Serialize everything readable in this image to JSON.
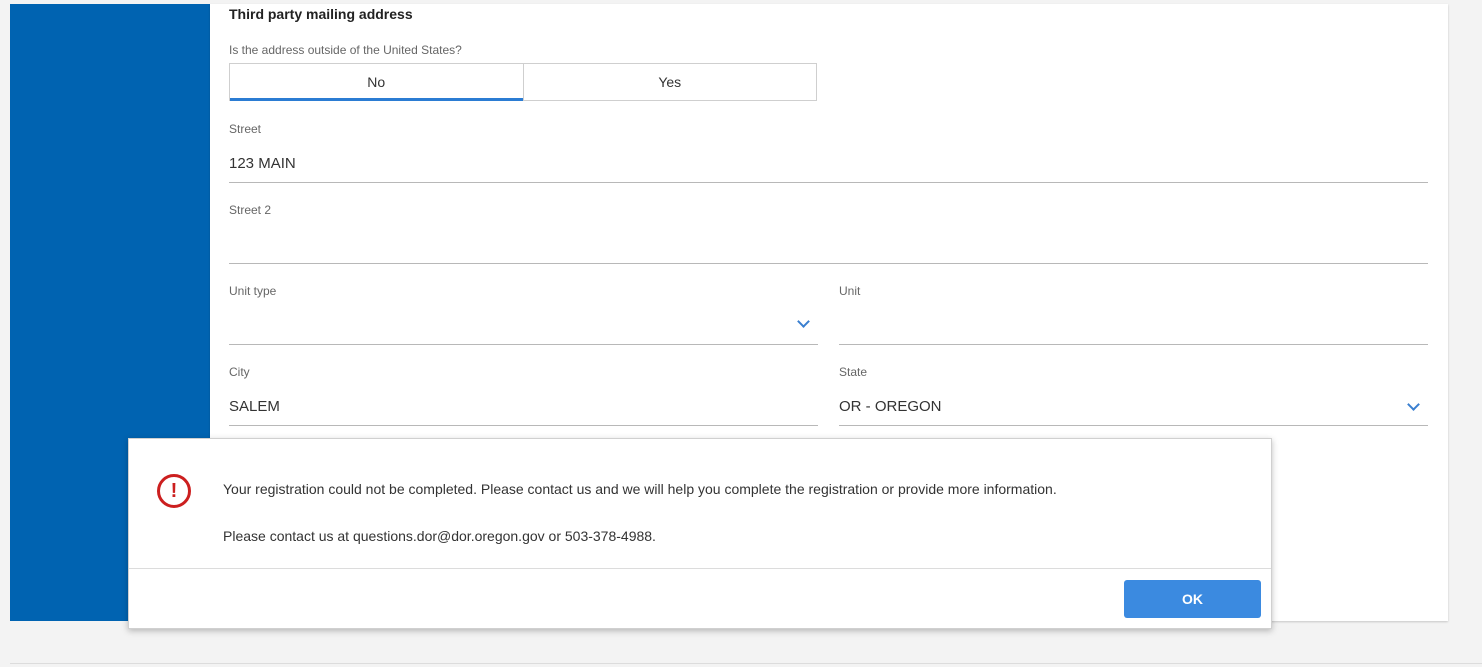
{
  "form": {
    "section_title": "Third party mailing address",
    "outside_us_question": "Is the address outside of the United States?",
    "toggle": {
      "no_label": "No",
      "yes_label": "Yes",
      "selected": "No"
    },
    "street": {
      "label": "Street",
      "value": "123 MAIN"
    },
    "street2": {
      "label": "Street 2",
      "value": ""
    },
    "unit_type": {
      "label": "Unit type",
      "value": ""
    },
    "unit": {
      "label": "Unit",
      "value": ""
    },
    "city": {
      "label": "City",
      "value": "SALEM"
    },
    "state": {
      "label": "State",
      "value": "OR - OREGON"
    }
  },
  "dialog": {
    "message": "Your registration could not be completed. Please contact us and we will help you complete the registration or provide more information.",
    "contact": "Please contact us at questions.dor@dor.oregon.gov or 503-378-4988.",
    "ok_label": "OK",
    "icon": "alert-circle-icon"
  },
  "colors": {
    "brand_blue": "#0063b1",
    "accent_blue": "#3b8ae0",
    "error_red": "#cc1f1f"
  }
}
